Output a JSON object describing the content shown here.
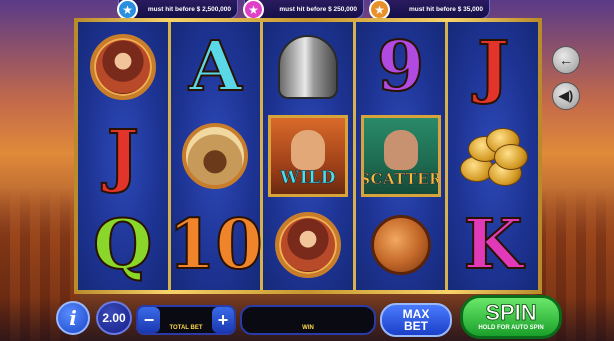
{
  "jackpots": [
    {
      "text": "must hit before $ 2,500,000",
      "color": "#2a8fe0",
      "icon": "star-icon"
    },
    {
      "text": "must hit before $ 250,000",
      "color": "#e040c8",
      "icon": "star-icon"
    },
    {
      "text": "must hit before $ 35,000",
      "color": "#e8902a",
      "icon": "star-icon"
    }
  ],
  "reels": [
    [
      {
        "type": "portrait-woman"
      },
      {
        "type": "letter",
        "text": "J",
        "color": "#e2342a"
      },
      {
        "type": "letter",
        "text": "Q",
        "color": "#8ad62a"
      }
    ],
    [
      {
        "type": "letter",
        "text": "A",
        "color": "#5ad8e8"
      },
      {
        "type": "chariot"
      },
      {
        "type": "letter",
        "text": "10",
        "color": "#f0842a"
      }
    ],
    [
      {
        "type": "helmet"
      },
      {
        "type": "wild",
        "text": "WILD"
      },
      {
        "type": "portrait-woman"
      }
    ],
    [
      {
        "type": "letter",
        "text": "9",
        "color": "#b04ae0"
      },
      {
        "type": "scatter",
        "text": "SCATTER"
      },
      {
        "type": "shield"
      }
    ],
    [
      {
        "type": "letter",
        "text": "J",
        "color": "#e2342a"
      },
      {
        "type": "coins"
      },
      {
        "type": "letter",
        "text": "K",
        "color": "#e03ab8"
      }
    ]
  ],
  "side_buttons": {
    "back_icon": "←",
    "sound_icon": "🔊"
  },
  "controls": {
    "info_label": "i",
    "bet_value": "2.00",
    "minus": "−",
    "plus": "+",
    "total_bet_label": "TOTAL BET",
    "win_label": "WIN",
    "max_bet_line1": "MAX",
    "max_bet_line2": "BET",
    "spin_label": "SPIN",
    "spin_sub": "HOLD FOR AUTO SPIN"
  }
}
